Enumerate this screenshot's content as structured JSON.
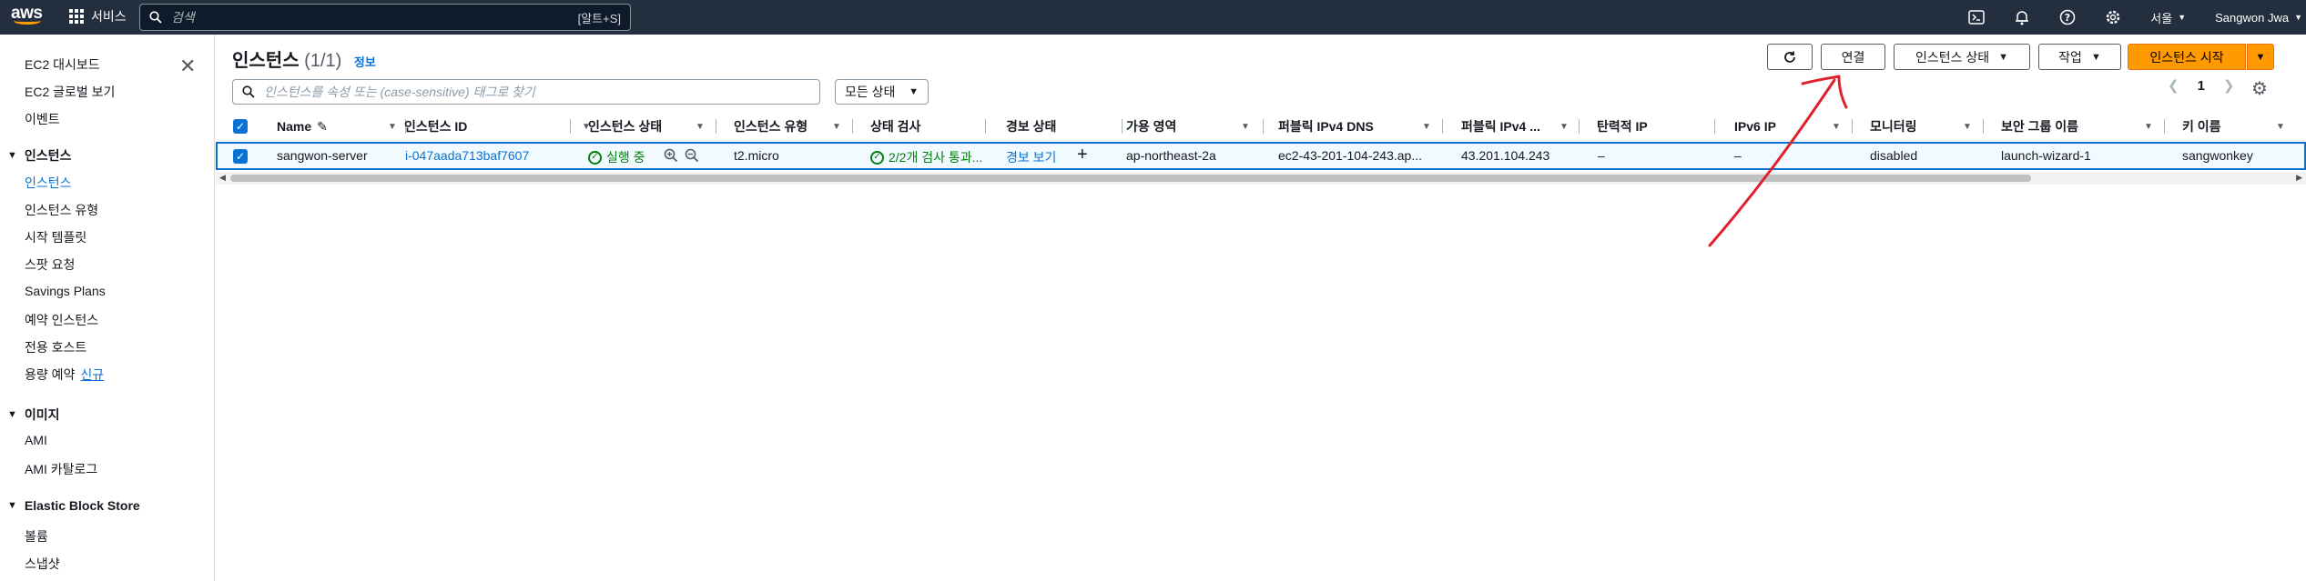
{
  "topbar": {
    "logo": "aws",
    "services_label": "서비스",
    "search_placeholder": "검색",
    "search_shortcut": "[알트+S]",
    "region": "서울",
    "user": "Sangwon Jwa"
  },
  "sidebar": {
    "top_items": [
      "EC2 대시보드",
      "EC2 글로벌 보기",
      "이벤트"
    ],
    "sections": [
      {
        "title": "인스턴스",
        "items": [
          "인스턴스",
          "인스턴스 유형",
          "시작 템플릿",
          "스팟 요청",
          "Savings Plans",
          "예약 인스턴스",
          "전용 호스트",
          "용량 예약"
        ]
      },
      {
        "title": "이미지",
        "items": [
          "AMI",
          "AMI 카탈로그"
        ]
      },
      {
        "title": "Elastic Block Store",
        "items": [
          "볼륨",
          "스냅샷"
        ]
      }
    ],
    "new_badge": "신규"
  },
  "main": {
    "title": "인스턴스",
    "count": "(1/1)",
    "info": "정보",
    "filter_placeholder": "인스턴스를 속성 또는 (case-sensitive) 태그로 찾기",
    "state_filter": "모든 상태",
    "buttons": {
      "connect": "연결",
      "instance_state": "인스턴스 상태",
      "actions": "작업",
      "launch": "인스턴스 시작"
    },
    "page": "1"
  },
  "table": {
    "columns": [
      "Name",
      "인스턴스 ID",
      "인스턴스 상태",
      "인스턴스 유형",
      "상태 검사",
      "경보 상태",
      "가용 영역",
      "퍼블릭 IPv4 DNS",
      "퍼블릭 IPv4 ...",
      "탄력적 IP",
      "IPv6 IP",
      "모니터링",
      "보안 그룹 이름",
      "키 이름"
    ],
    "row": {
      "name": "sangwon-server",
      "instance_id": "i-047aada713baf7607",
      "state": "실행 중",
      "type": "t2.micro",
      "status_check": "2/2개 검사 통과...",
      "alarm": "경보 보기",
      "az": "ap-northeast-2a",
      "dns": "ec2-43-201-104-243.ap...",
      "ipv4": "43.201.104.243",
      "eip": "–",
      "ipv6": "–",
      "monitoring": "disabled",
      "sg": "launch-wizard-1",
      "key": "sangwonkey"
    }
  },
  "colors": {
    "topbar": "#232f3e",
    "accent": "#ff9900",
    "link": "#0972d3",
    "success": "#037f0c",
    "annotation": "#e0202a"
  }
}
